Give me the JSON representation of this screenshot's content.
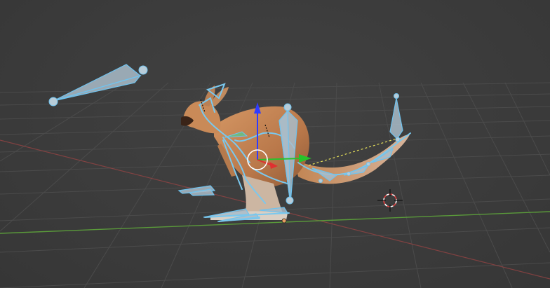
{
  "viewport": {
    "background": "#3d3d3d",
    "grid_color": "#4b4b4b",
    "x_axis_color": "#a04545",
    "y_axis_color": "#5a9a3a"
  },
  "armature": {
    "bone_color": "#a9bcc9",
    "bone_outline_color": "#6fc3ef",
    "ik_line_color": "#e6e05a"
  },
  "mesh": {
    "name_icon": "kangaroo-mesh",
    "fur_color": "#c98a58"
  },
  "gizmo": {
    "z_color": "#2f3cff",
    "y_color": "#27c42b",
    "x_color": "#e03030",
    "ring_color": "#ffffff"
  },
  "cursor": {
    "icon": "3d-cursor-icon",
    "ring_colors": [
      "#e04040",
      "#ffffff"
    ]
  },
  "origin": {
    "icon": "object-origin-icon",
    "color": "#e8a060"
  }
}
